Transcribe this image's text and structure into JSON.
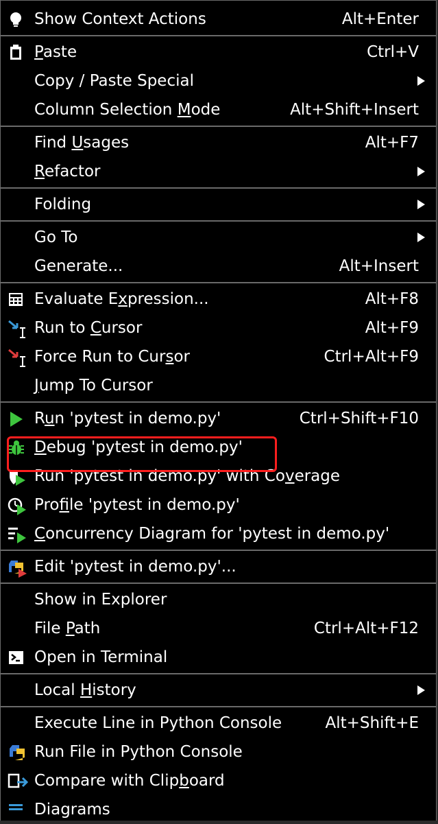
{
  "menu": {
    "sections": [
      [
        {
          "id": "show-context-actions",
          "pre": "Show Context Actions",
          "mn": "",
          "post": "",
          "shortcut": "Alt+Enter",
          "icon": "lightbulb-icon"
        }
      ],
      [
        {
          "id": "paste",
          "pre": "",
          "mn": "P",
          "post": "aste",
          "shortcut": "Ctrl+V",
          "icon": "clipboard-icon"
        },
        {
          "id": "copy-paste-special",
          "pre": "Copy / Paste Special",
          "mn": "",
          "post": "",
          "submenu": true
        },
        {
          "id": "column-selection-mode",
          "pre": "Column Selection ",
          "mn": "M",
          "post": "ode",
          "shortcut": "Alt+Shift+Insert"
        }
      ],
      [
        {
          "id": "find-usages",
          "pre": "Find ",
          "mn": "U",
          "post": "sages",
          "shortcut": "Alt+F7"
        },
        {
          "id": "refactor",
          "pre": "",
          "mn": "R",
          "post": "efactor",
          "submenu": true
        }
      ],
      [
        {
          "id": "folding",
          "pre": "Folding",
          "mn": "",
          "post": "",
          "submenu": true
        }
      ],
      [
        {
          "id": "go-to",
          "pre": "Go To",
          "mn": "",
          "post": "",
          "submenu": true
        },
        {
          "id": "generate",
          "pre": "Generate...",
          "mn": "",
          "post": "",
          "shortcut": "Alt+Insert"
        }
      ],
      [
        {
          "id": "evaluate-expression",
          "pre": "Evaluate E",
          "mn": "x",
          "post": "pression...",
          "shortcut": "Alt+F8",
          "icon": "calculator-icon"
        },
        {
          "id": "run-to-cursor",
          "pre": "Run to ",
          "mn": "C",
          "post": "ursor",
          "shortcut": "Alt+F9",
          "icon": "run-to-cursor-icon"
        },
        {
          "id": "force-run-to-cursor",
          "pre": "Force Run to Cur",
          "mn": "s",
          "post": "or",
          "shortcut": "Ctrl+Alt+F9",
          "icon": "force-run-to-cursor-icon"
        },
        {
          "id": "jump-to-cursor",
          "pre": "",
          "mn": "J",
          "post": "ump To Cursor"
        }
      ],
      [
        {
          "id": "run-pytest",
          "pre": "R",
          "mn": "u",
          "post": "n 'pytest in demo.py'",
          "shortcut": "Ctrl+Shift+F10",
          "icon": "run-icon"
        },
        {
          "id": "debug-pytest",
          "pre": "",
          "mn": "D",
          "post": "ebug 'pytest in demo.py'",
          "icon": "debug-bug-icon"
        },
        {
          "id": "run-with-coverage",
          "pre": "Run 'pytest in demo.py' with Co",
          "mn": "v",
          "post": "erage",
          "icon": "coverage-icon"
        },
        {
          "id": "profile-pytest",
          "pre": "Pro",
          "mn": "f",
          "post": "ile 'pytest in demo.py'",
          "icon": "profiler-icon"
        },
        {
          "id": "concurrency-diagram",
          "pre": "",
          "mn": "C",
          "post": "oncurrency Diagram for 'pytest in demo.py'",
          "icon": "concurrency-diagram-icon"
        }
      ],
      [
        {
          "id": "edit-run-config",
          "pre": "Edit 'pytest in demo.py'...",
          "mn": "",
          "post": "",
          "icon": "python-run-config-icon"
        }
      ],
      [
        {
          "id": "show-in-explorer",
          "pre": "Show in Explorer",
          "mn": "",
          "post": ""
        },
        {
          "id": "file-path",
          "pre": "File ",
          "mn": "P",
          "post": "ath",
          "shortcut": "Ctrl+Alt+F12"
        },
        {
          "id": "open-in-terminal",
          "pre": "Open in Terminal",
          "mn": "",
          "post": "",
          "icon": "terminal-icon"
        }
      ],
      [
        {
          "id": "local-history",
          "pre": "Local ",
          "mn": "H",
          "post": "istory",
          "submenu": true
        }
      ],
      [
        {
          "id": "execute-line-python-console",
          "pre": "Execute Line in Python Console",
          "mn": "",
          "post": "",
          "shortcut": "Alt+Shift+E"
        },
        {
          "id": "run-file-python-console",
          "pre": "Run File in Python Console",
          "mn": "",
          "post": "",
          "icon": "python-icon"
        },
        {
          "id": "compare-with-clipboard",
          "pre": "Compare with Clip",
          "mn": "b",
          "post": "oard",
          "icon": "compare-clipboard-icon"
        },
        {
          "id": "diagrams",
          "pre": "Diagrams",
          "mn": "",
          "post": "",
          "icon": "diagrams-icon"
        }
      ]
    ]
  },
  "colors": {
    "background": "#000000",
    "text": "#ffffff",
    "separator": "#6a6a6a",
    "highlight": "#ff1e1e",
    "run_green": "#3ec53e",
    "accent_blue": "#3a9ad9",
    "accent_red": "#e03c3c"
  }
}
